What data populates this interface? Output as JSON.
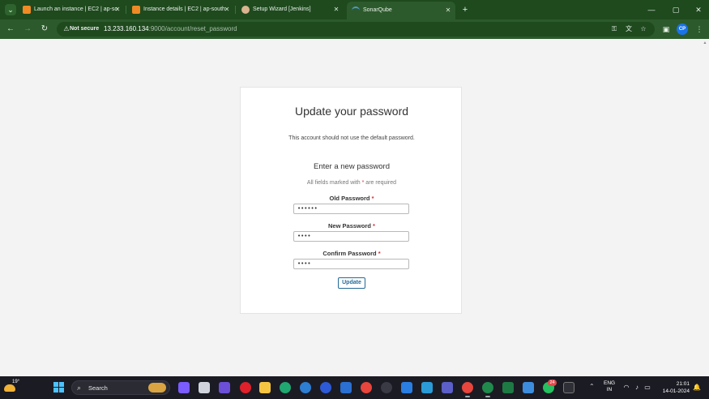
{
  "browser": {
    "tabs": [
      {
        "title": "Launch an instance | EC2 | ap-so",
        "favicon": "aws-icon",
        "color": "#f08a24"
      },
      {
        "title": "Instance details | EC2 | ap-south",
        "favicon": "aws-icon",
        "color": "#f08a24"
      },
      {
        "title": "Setup Wizard [Jenkins]",
        "favicon": "jenkins-icon",
        "color": "#d9b48f"
      },
      {
        "title": "SonarQube",
        "favicon": "sonarqube-icon",
        "color": "#4e9bcd",
        "active": true
      }
    ],
    "address": {
      "security_label": "Not secure",
      "url_host": "13.233.160.134",
      "url_path": ":9000/account/reset_password"
    },
    "profile_initials": "CP",
    "theme_color": "#2c5a2c"
  },
  "page": {
    "title": "Update your password",
    "subtitle": "This account should not use the default password.",
    "section_title": "Enter a new password",
    "required_note_prefix": "All fields marked with ",
    "required_note_star": "*",
    "required_note_suffix": " are required",
    "fields": [
      {
        "label": "Old Password",
        "value": "••••••"
      },
      {
        "label": "New Password",
        "value": "••••"
      },
      {
        "label": "Confirm Password",
        "value": "••••"
      }
    ],
    "required_star": "*",
    "submit_label": "Update",
    "accent_color": "#236a97"
  },
  "taskbar": {
    "weather_temp": "19°",
    "search_label": "Search",
    "notification_badge": "24",
    "language": {
      "line1": "ENG",
      "line2": "IN"
    },
    "clock": {
      "time": "21:01",
      "date": "14-01-2024"
    }
  }
}
